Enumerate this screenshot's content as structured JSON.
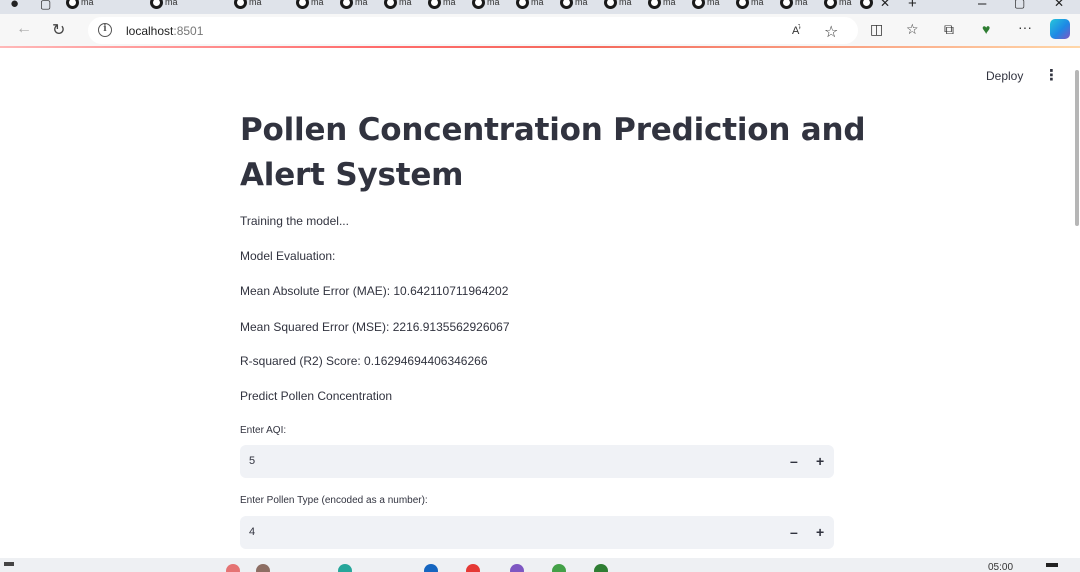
{
  "browser": {
    "tab_label": "ma",
    "url_host": "localhost",
    "url_port": ":8501",
    "read_aloud_label": "A’̀"
  },
  "streamlit": {
    "deploy_label": "Deploy",
    "menu_glyph": "⋮"
  },
  "page": {
    "title": "Pollen Concentration Prediction and Alert System",
    "status_training": "Training the model...",
    "evaluation_heading": "Model Evaluation:",
    "mae_line": "Mean Absolute Error (MAE): 10.642110711964202",
    "mse_line": "Mean Squared Error (MSE): 2216.9135562926067",
    "r2_line": "R-squared (R2) Score: 0.16294694406346266",
    "predict_heading": "Predict Pollen Concentration",
    "inputs": [
      {
        "label": "Enter AQI:",
        "value": "5"
      },
      {
        "label": "Enter Pollen Type (encoded as a number):",
        "value": "4"
      }
    ],
    "minus_glyph": "–",
    "plus_glyph": "+"
  },
  "taskbar": {
    "clock": "05:00"
  },
  "icons": {
    "back": "arrow-left-icon",
    "refresh": "refresh-icon",
    "info": "info-icon",
    "favorite": "star-icon",
    "split": "split-screen-icon",
    "favorites_bar": "favorites-list-icon",
    "collections": "collections-icon",
    "extensions": "heart-pulse-icon",
    "more": "more-icon",
    "copilot": "copilot-icon"
  },
  "colors": {
    "text": "#31333f",
    "input_bg": "#f0f2f6",
    "loading_accent": "#ff6b6b",
    "copilot": "#1e88e5"
  }
}
